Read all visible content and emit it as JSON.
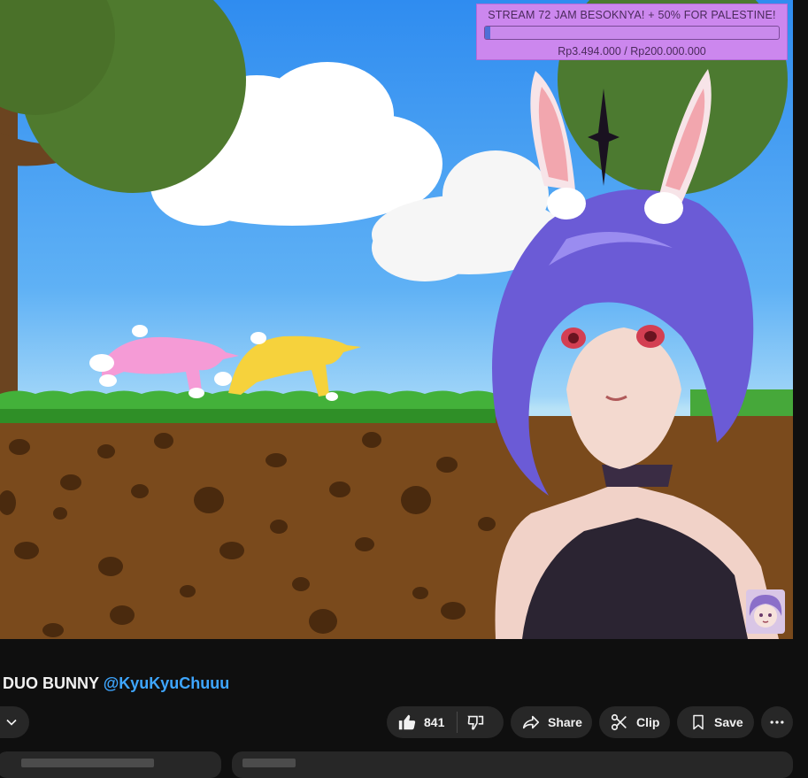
{
  "video": {
    "donation_goal": {
      "title": "STREAM 72 JAM BESOKNYA! + 50% FOR PALESTINE!",
      "amount_text": "Rp3.494.000 / Rp200.000.000",
      "progress_fraction": 0.017,
      "bar_color": "#4f6fd6",
      "panel_color": "#cc87ee"
    }
  },
  "metadata": {
    "title": "DUO BUNNY",
    "channel_handle": "@KyuKyuChuuu"
  },
  "actions": {
    "like_count": "841",
    "share_label": "Share",
    "clip_label": "Clip",
    "save_label": "Save"
  },
  "icons": {
    "menu": "chevron-down-icon",
    "like": "thumbs-up-icon",
    "dislike": "thumbs-down-icon",
    "share": "share-arrow-icon",
    "clip": "scissors-icon",
    "save": "bookmark-icon",
    "more": "more-horizontal-icon"
  },
  "colors": {
    "background": "#0f0f0f",
    "button": "#272727",
    "link": "#3ea6ff"
  }
}
